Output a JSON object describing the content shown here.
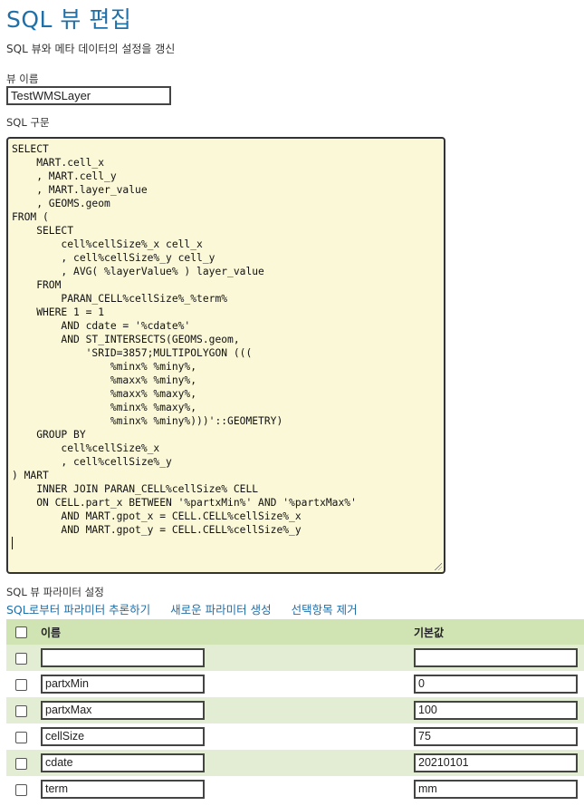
{
  "page": {
    "title": "SQL 뷰 편집",
    "subtitle": "SQL 뷰와 메타 데이터의 설정을 갱신"
  },
  "view_name": {
    "label": "뷰 이름",
    "value": "TestWMSLayer"
  },
  "sql": {
    "label": "SQL 구문",
    "text": "SELECT\n    MART.cell_x\n    , MART.cell_y\n    , MART.layer_value\n    , GEOMS.geom\nFROM (\n    SELECT\n        cell%cellSize%_x cell_x\n        , cell%cellSize%_y cell_y\n        , AVG( %layerValue% ) layer_value\n    FROM\n        PARAN_CELL%cellSize%_%term%\n    WHERE 1 = 1\n        AND cdate = '%cdate%'\n        AND ST_INTERSECTS(GEOMS.geom,\n            'SRID=3857;MULTIPOLYGON (((\n                %minx% %miny%,\n                %maxx% %miny%,\n                %maxx% %maxy%,\n                %minx% %maxy%,\n                %minx% %miny%)))'::GEOMETRY)\n    GROUP BY\n        cell%cellSize%_x\n        , cell%cellSize%_y\n) MART\n    INNER JOIN PARAN_CELL%cellSize% CELL\n    ON CELL.part_x BETWEEN '%partxMin%' AND '%partxMax%'\n        AND MART.gpot_x = CELL.CELL%cellSize%_x\n        AND MART.gpot_y = CELL.CELL%cellSize%_y\n"
  },
  "params": {
    "label": "SQL 뷰 파라미터 설정",
    "links": {
      "infer": "SQL로부터 파라미터 추론하기",
      "create": "새로운 파라미터 생성",
      "remove": "선택항목 제거"
    },
    "headers": {
      "name": "이름",
      "default": "기본값"
    },
    "rows": [
      {
        "name": "",
        "default": ""
      },
      {
        "name": "partxMin",
        "default": "0"
      },
      {
        "name": "partxMax",
        "default": "100"
      },
      {
        "name": "cellSize",
        "default": "75"
      },
      {
        "name": "cdate",
        "default": "20210101"
      },
      {
        "name": "term",
        "default": "mm"
      }
    ]
  }
}
